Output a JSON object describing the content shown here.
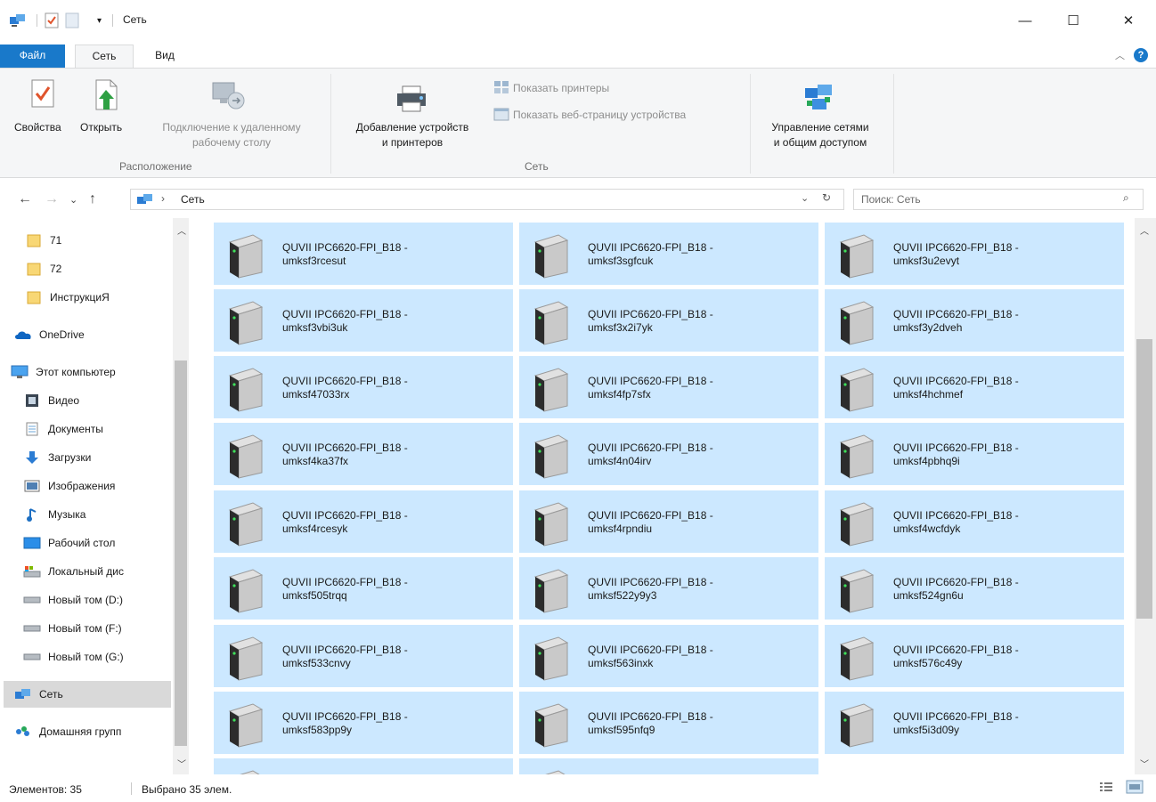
{
  "window": {
    "title": "Сеть",
    "minimize_icon": "minimize-icon",
    "maximize_icon": "maximize-icon",
    "close_icon": "close-icon",
    "minimize_glyph": "—",
    "maximize_glyph": "☐",
    "close_glyph": "✕"
  },
  "ribbon_tabs": {
    "file": "Файл",
    "network": "Сеть",
    "view": "Вид"
  },
  "ribbon": {
    "location_group": {
      "label": "Расположение",
      "properties": "Свойства",
      "open": "Открыть",
      "remote_line1": "Подключение к удаленному",
      "remote_line2": "рабочему столу"
    },
    "network_group": {
      "label": "Сеть",
      "add_devices_line1": "Добавление устройств",
      "add_devices_line2": "и принтеров",
      "show_printers": "Показать принтеры",
      "show_webpage": "Показать веб-страницу устройства"
    },
    "sharing": {
      "line1": "Управление сетями",
      "line2": "и общим доступом"
    }
  },
  "address": {
    "crumb": "Сеть",
    "search_placeholder": "Поиск: Сеть"
  },
  "nav": [
    {
      "label": "71",
      "icon": "folder-icon"
    },
    {
      "label": "72",
      "icon": "folder-icon"
    },
    {
      "label": "ИнструкциЯ",
      "icon": "folder-icon"
    },
    {
      "label": "OneDrive",
      "icon": "onedrive-icon"
    },
    {
      "label": "Этот компьютер",
      "icon": "computer-icon"
    },
    {
      "label": "Видео",
      "icon": "video-icon"
    },
    {
      "label": "Документы",
      "icon": "documents-icon"
    },
    {
      "label": "Загрузки",
      "icon": "downloads-icon"
    },
    {
      "label": "Изображения",
      "icon": "pictures-icon"
    },
    {
      "label": "Музыка",
      "icon": "music-icon"
    },
    {
      "label": "Рабочий стол",
      "icon": "desktop-icon"
    },
    {
      "label": "Локальный дис",
      "icon": "local-disk-icon"
    },
    {
      "label": "Новый том (D:)",
      "icon": "drive-icon"
    },
    {
      "label": "Новый том (F:)",
      "icon": "drive-icon"
    },
    {
      "label": "Новый том (G:)",
      "icon": "drive-icon"
    },
    {
      "label": "Сеть",
      "icon": "network-icon"
    },
    {
      "label": "Домашняя групп",
      "icon": "homegroup-icon"
    }
  ],
  "devices": [
    {
      "line1": "QUVII IPC6620-FPI_B18 -",
      "line2": "umksf3rcesut"
    },
    {
      "line1": "QUVII IPC6620-FPI_B18 -",
      "line2": "umksf3sgfcuk"
    },
    {
      "line1": "QUVII IPC6620-FPI_B18 -",
      "line2": "umksf3u2evyt"
    },
    {
      "line1": "QUVII IPC6620-FPI_B18 -",
      "line2": "umksf3vbi3uk"
    },
    {
      "line1": "QUVII IPC6620-FPI_B18 -",
      "line2": "umksf3x2i7yk"
    },
    {
      "line1": "QUVII IPC6620-FPI_B18 -",
      "line2": "umksf3y2dveh"
    },
    {
      "line1": "QUVII IPC6620-FPI_B18 -",
      "line2": "umksf47033rx"
    },
    {
      "line1": "QUVII IPC6620-FPI_B18 -",
      "line2": "umksf4fp7sfx"
    },
    {
      "line1": "QUVII IPC6620-FPI_B18 -",
      "line2": "umksf4hchmef"
    },
    {
      "line1": "QUVII IPC6620-FPI_B18 -",
      "line2": "umksf4ka37fx"
    },
    {
      "line1": "QUVII IPC6620-FPI_B18 -",
      "line2": "umksf4n04irv"
    },
    {
      "line1": "QUVII IPC6620-FPI_B18 -",
      "line2": "umksf4pbhq9i"
    },
    {
      "line1": "QUVII IPC6620-FPI_B18 -",
      "line2": "umksf4rcesyk"
    },
    {
      "line1": "QUVII IPC6620-FPI_B18 -",
      "line2": "umksf4rpndiu"
    },
    {
      "line1": "QUVII IPC6620-FPI_B18 -",
      "line2": "umksf4wcfdyk"
    },
    {
      "line1": "QUVII IPC6620-FPI_B18 -",
      "line2": "umksf505trqq"
    },
    {
      "line1": "QUVII IPC6620-FPI_B18 -",
      "line2": "umksf522y9y3"
    },
    {
      "line1": "QUVII IPC6620-FPI_B18 -",
      "line2": "umksf524gn6u"
    },
    {
      "line1": "QUVII IPC6620-FPI_B18 -",
      "line2": "umksf533cnvy"
    },
    {
      "line1": "QUVII IPC6620-FPI_B18 -",
      "line2": "umksf563inxk"
    },
    {
      "line1": "QUVII IPC6620-FPI_B18 -",
      "line2": "umksf576c49y"
    },
    {
      "line1": "QUVII IPC6620-FPI_B18 -",
      "line2": "umksf583pp9y"
    },
    {
      "line1": "QUVII IPC6620-FPI_B18 -",
      "line2": "umksf595nfq9"
    },
    {
      "line1": "QUVII IPC6620-FPI_B18 -",
      "line2": "umksf5i3d09y"
    }
  ],
  "status": {
    "items": "Элементов: 35",
    "selected": "Выбрано 35 элем."
  },
  "colors": {
    "accent": "#1979ca",
    "selection": "#cce8ff"
  }
}
